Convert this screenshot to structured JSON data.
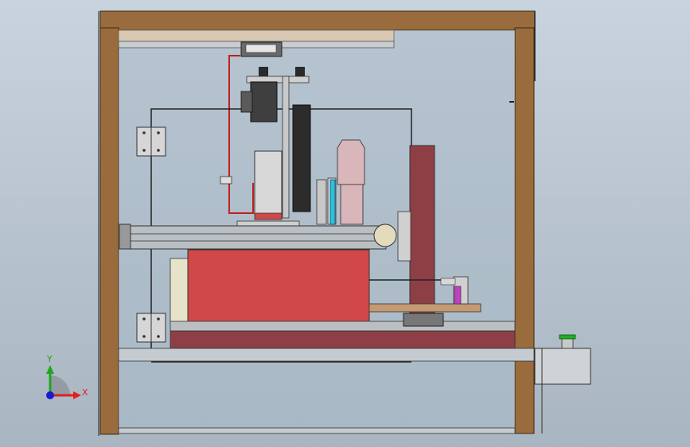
{
  "viewport": {
    "background_top": "#c9d3dd",
    "background_bottom": "#a9b6c2"
  },
  "triad": {
    "y_label": "Y",
    "x_label": "X",
    "y_color": "#1fa51f",
    "x_color": "#e02020",
    "z_color": "#1a1ad0"
  },
  "colors": {
    "frame_wood": "#9a6b3c",
    "frame_wood_dark": "#5c3c1c",
    "panel_glass": "#a8b9c6",
    "red_block": "#d04848",
    "dark_red_block": "#8e3f46",
    "pink_cylinder": "#d9b6ba",
    "rail_grey": "#b9bfc3",
    "motor_dark": "#3f3f3f",
    "cable_red": "#c02020",
    "cyan_part": "#29c4d4",
    "magenta_part": "#c040c0",
    "green_button": "#20b020"
  },
  "icons": {
    "triad": "coordinate-triad-icon",
    "hinge": "hinge-icon"
  }
}
